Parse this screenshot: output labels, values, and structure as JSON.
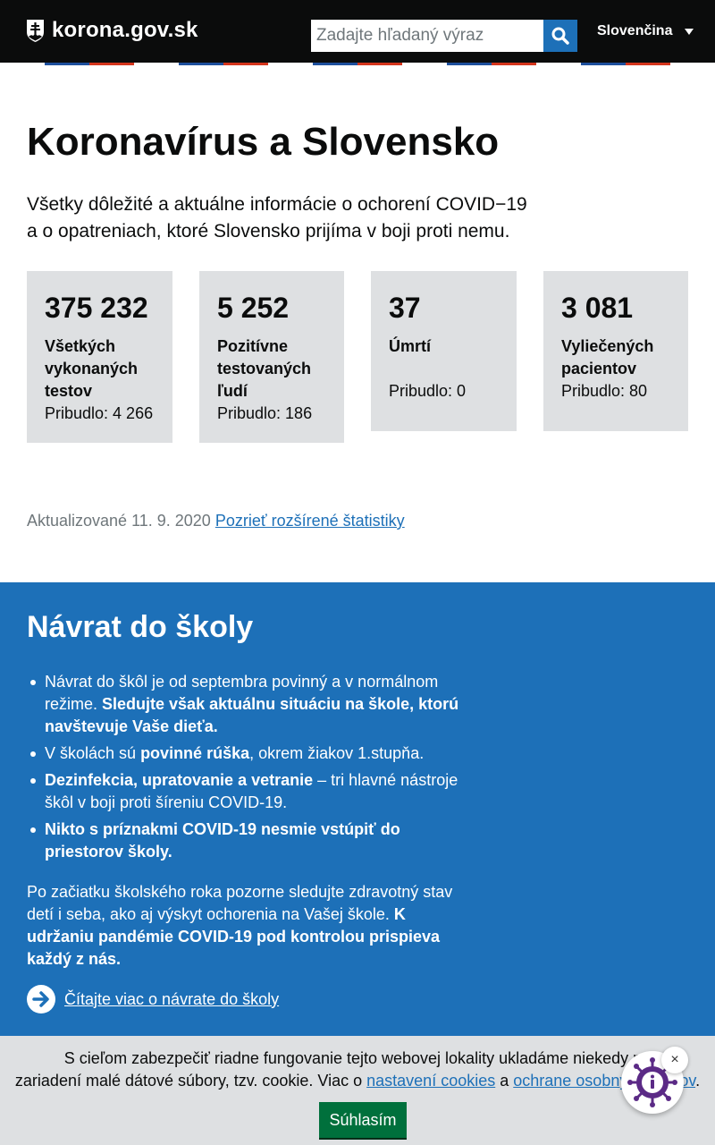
{
  "header": {
    "site_name": "korona.gov.sk",
    "search_placeholder": "Zadajte hľadaný výraz",
    "language": "Slovenčina"
  },
  "main": {
    "title": "Koronavírus a Slovensko",
    "lead_line1": "Všetky dôležité a aktuálne informácie o ochorení COVID−19",
    "lead_line2": "a o opatreniach, ktoré Slovensko prijíma v boji proti nemu.",
    "stats": [
      {
        "value": "375 232",
        "label": "Všetkých vykonaných testov",
        "delta": "Pribudlo: 4 266"
      },
      {
        "value": "5 252",
        "label": "Pozitívne testovaných ľudí",
        "delta": "Pribudlo: 186"
      },
      {
        "value": "37",
        "label": "Úmrtí",
        "delta": "Pribudlo: 0"
      },
      {
        "value": "3 081",
        "label": "Vyliečených pacientov",
        "delta": "Pribudlo: 80"
      }
    ],
    "updated_text": "Aktualizované 11. 9. 2020",
    "stats_link": "Pozrieť rozšírené štatistiky"
  },
  "school": {
    "title": "Návrat do školy",
    "b1_text": "Návrat do škôl je od septembra povinný a v normálnom režime. ",
    "b1_bold": "Sledujte však aktuálnu situáciu na škole, ktorú navštevuje Vaše dieťa.",
    "b2_pre": "V školách sú ",
    "b2_bold": "povinné rúška",
    "b2_post": ", okrem žiakov 1.stupňa.",
    "b3_bold": "Dezinfekcia, upratovanie a vetranie",
    "b3_post": " – tri hlavné nástroje škôl v boji proti šíreniu COVID-19.",
    "b4_bold": "Nikto s príznakmi COVID-19 nesmie vstúpiť do priestorov školy.",
    "para_text": "Po začiatku školského roka pozorne sledujte zdravotný stav detí i seba, ako aj výskyt ochorenia na Vašej škole. ",
    "para_bold": "K udržaniu pandémie COVID-19 pod kontrolou prispieva každý z nás.",
    "more_link": "Čítajte viac o návrate do školy"
  },
  "cookie": {
    "line1": "S cieľom zabezpečiť riadne fungovanie tejto webovej lokality ukladáme niekedy na",
    "line2_pre": "zariadení malé dátové súbory, tzv. cookie. Viac o ",
    "link_cookies": "nastavení cookies",
    "and": " a ",
    "link_privacy": "ochrane osobných údajov",
    "line2_end": ".",
    "agree_label": "Súhlasím",
    "close_glyph": "×"
  },
  "colors": {
    "header_bg": "#0b0c0c",
    "accent_blue": "#1d70b8",
    "card_bg": "#dee0e2",
    "agree_green": "#00703c",
    "chat_purple": "#5b2a86"
  }
}
